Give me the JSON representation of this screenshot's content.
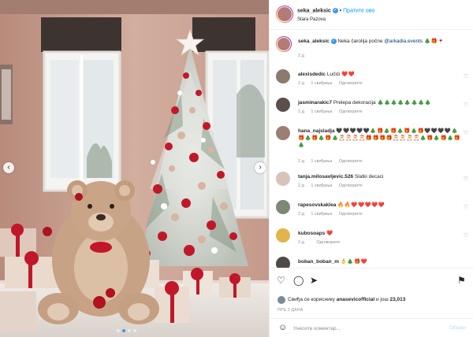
{
  "header": {
    "username": "seka_aleksic",
    "separator": "•",
    "follow_label": "Пратите ово",
    "location": "Stara Pazova"
  },
  "caption": {
    "username": "seka_aleksic",
    "text": "Neka čarolija počne",
    "mention": "@arkadia.events",
    "emoji": "🎄🎁🍷",
    "time": "2 д"
  },
  "comments": [
    {
      "username": "alexisdedic",
      "text": "Lučići",
      "emoji": "❤️❤️",
      "time": "2 д",
      "likes": "1 свиђања",
      "reply": "Одговорите"
    },
    {
      "username": "jasminarakic7",
      "text": "Prelepa dekoracija",
      "emoji": "🎄🎄🎄🎄🎄🎄🎄🎄",
      "time": "2 д",
      "likes": "1 свиђања",
      "reply": "Одговорите"
    },
    {
      "username": "hana_najsladja",
      "text": "",
      "emoji": "🖤🖤🖤🖤🖤🎄🎁🎄🎁🎄🎁🎄🎁🖤🖤🖤🖤🎄🎁🎄🎁🎄🎁🎄🎅🎅🎅🎅🎁🎁🎁🎁🎅🎅🎅🎅🎄🎁🎄🎁🎄🎁🎄",
      "time": "2 д",
      "likes": "1 свиђања",
      "reply": "Одговорите"
    },
    {
      "username": "tanja.milosavljevic.526",
      "text": "Slatki decaci",
      "emoji": "",
      "time": "2 д",
      "likes": "1 свиђања",
      "reply": "Одговорите"
    },
    {
      "username": "rapesovskaklea",
      "text": "",
      "emoji": "🔥🔥❤️❤️❤️❤️❤️",
      "time": "2 д",
      "likes": "1 свиђања",
      "reply": "Одговорите"
    },
    {
      "username": "kubosoaps",
      "text": "",
      "emoji": "❤️",
      "time": "2 д",
      "likes": "",
      "reply": "Одговорите"
    },
    {
      "username": "boban_boban_m",
      "text": "",
      "emoji": "👌🎄🎁❤️",
      "time": "",
      "likes": "",
      "reply": ""
    }
  ],
  "actions": {
    "liked_by_prefix": "Свиђа се кориснику",
    "liked_by_user": "anasevicofficial",
    "liked_by_suffix": "и још",
    "liked_count": "23,013",
    "date": "ПРЕ 2 ДАНА"
  },
  "comment_box": {
    "placeholder": "Унесите коментар...",
    "post_label": "Објави"
  },
  "colors": {
    "link_blue": "#0095f6",
    "mention": "#00376b",
    "muted": "#8e8e8e",
    "wall": "#c9a494",
    "ornament_red": "#c0182a"
  }
}
